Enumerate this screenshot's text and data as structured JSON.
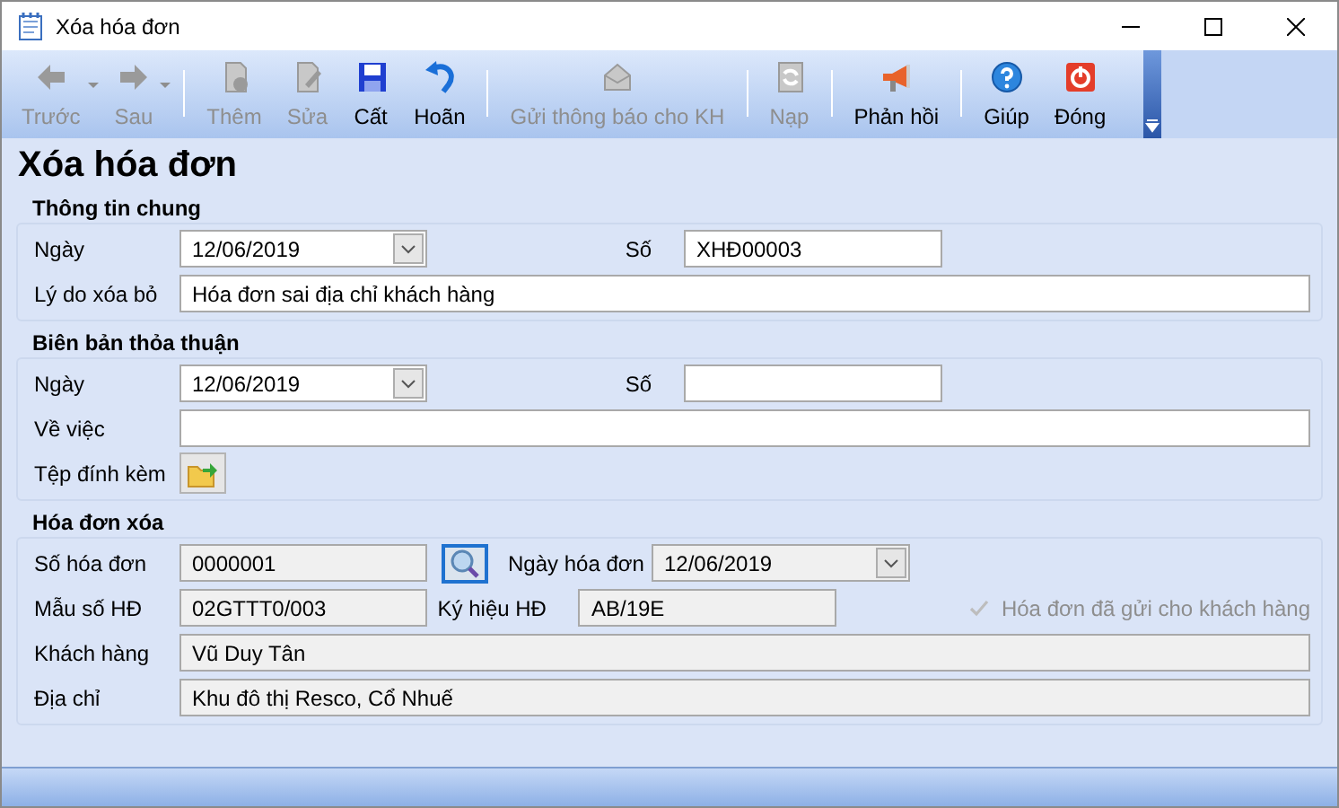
{
  "window": {
    "title": "Xóa hóa đơn"
  },
  "toolbar": [
    {
      "kind": "button",
      "label": "Trước",
      "disabled": true,
      "dropdown": true
    },
    {
      "kind": "button",
      "label": "Sau",
      "disabled": true,
      "dropdown": true
    },
    {
      "kind": "separator"
    },
    {
      "kind": "button",
      "label": "Thêm",
      "disabled": true,
      "dropdown": false
    },
    {
      "kind": "button",
      "label": "Sửa",
      "disabled": true,
      "dropdown": false
    },
    {
      "kind": "button",
      "label": "Cất",
      "disabled": false,
      "dropdown": false
    },
    {
      "kind": "button",
      "label": "Hoãn",
      "disabled": false,
      "dropdown": false
    },
    {
      "kind": "separator"
    },
    {
      "kind": "button",
      "label": "Gửi thông báo cho KH",
      "disabled": true,
      "dropdown": false
    },
    {
      "kind": "separator"
    },
    {
      "kind": "button",
      "label": "Nạp",
      "disabled": true,
      "dropdown": false
    },
    {
      "kind": "separator"
    },
    {
      "kind": "button",
      "label": "Phản hồi",
      "disabled": false,
      "dropdown": false
    },
    {
      "kind": "separator"
    },
    {
      "kind": "button",
      "label": "Giúp",
      "disabled": false,
      "dropdown": false
    },
    {
      "kind": "button",
      "label": "Đóng",
      "disabled": false,
      "dropdown": false
    }
  ],
  "heading": "Xóa hóa đơn",
  "sections": [
    {
      "title": "Thông tin chung",
      "rows": [
        [
          {
            "kind": "label",
            "text": "Ngày"
          },
          {
            "kind": "date",
            "value": "12/06/2019",
            "readonly": false
          },
          {
            "kind": "label",
            "text": "Số"
          },
          {
            "kind": "text",
            "value": "XHĐ00003",
            "readonly": false
          }
        ],
        [
          {
            "kind": "label",
            "text": "Lý do xóa bỏ"
          },
          {
            "kind": "text",
            "value": "Hóa đơn sai địa chỉ khách hàng",
            "readonly": false
          }
        ]
      ]
    },
    {
      "title": "Biên bản thỏa thuận",
      "rows": [
        [
          {
            "kind": "label",
            "text": "Ngày"
          },
          {
            "kind": "date",
            "value": "12/06/2019",
            "readonly": false
          },
          {
            "kind": "label",
            "text": "Số"
          },
          {
            "kind": "text",
            "readonly": false
          }
        ],
        [
          {
            "kind": "label",
            "text": "Về việc"
          },
          {
            "kind": "text",
            "readonly": false
          }
        ],
        [
          {
            "kind": "label",
            "text": "Tệp đính kèm"
          },
          {
            "kind": "attach"
          }
        ]
      ]
    },
    {
      "title": "Hóa đơn xóa",
      "rows": [
        [
          {
            "kind": "label",
            "text": "Số hóa đơn"
          },
          {
            "kind": "text",
            "value": "0000001",
            "readonly": true
          },
          {
            "kind": "lookup"
          },
          {
            "kind": "label",
            "text": "Ngày hóa đơn"
          },
          {
            "kind": "date",
            "value": "12/06/2019",
            "readonly": true
          }
        ],
        [
          {
            "kind": "label",
            "text": "Mẫu số HĐ"
          },
          {
            "kind": "text",
            "value": "02GTTT0/003",
            "readonly": true
          },
          {
            "kind": "label",
            "text": "Ký hiệu HĐ"
          },
          {
            "kind": "text",
            "value": "AB/19E",
            "readonly": true
          },
          {
            "kind": "checkbox",
            "label": "Hóa đơn đã gửi cho khách hàng",
            "checked": true,
            "disabled": true
          }
        ],
        [
          {
            "kind": "label",
            "text": "Khách hàng"
          },
          {
            "kind": "text",
            "value": "Vũ Duy Tân",
            "readonly": true
          }
        ],
        [
          {
            "kind": "label",
            "text": "Địa chỉ"
          },
          {
            "kind": "text",
            "value": "Khu đô thị Resco, Cổ Nhuế",
            "readonly": true
          }
        ]
      ]
    }
  ]
}
